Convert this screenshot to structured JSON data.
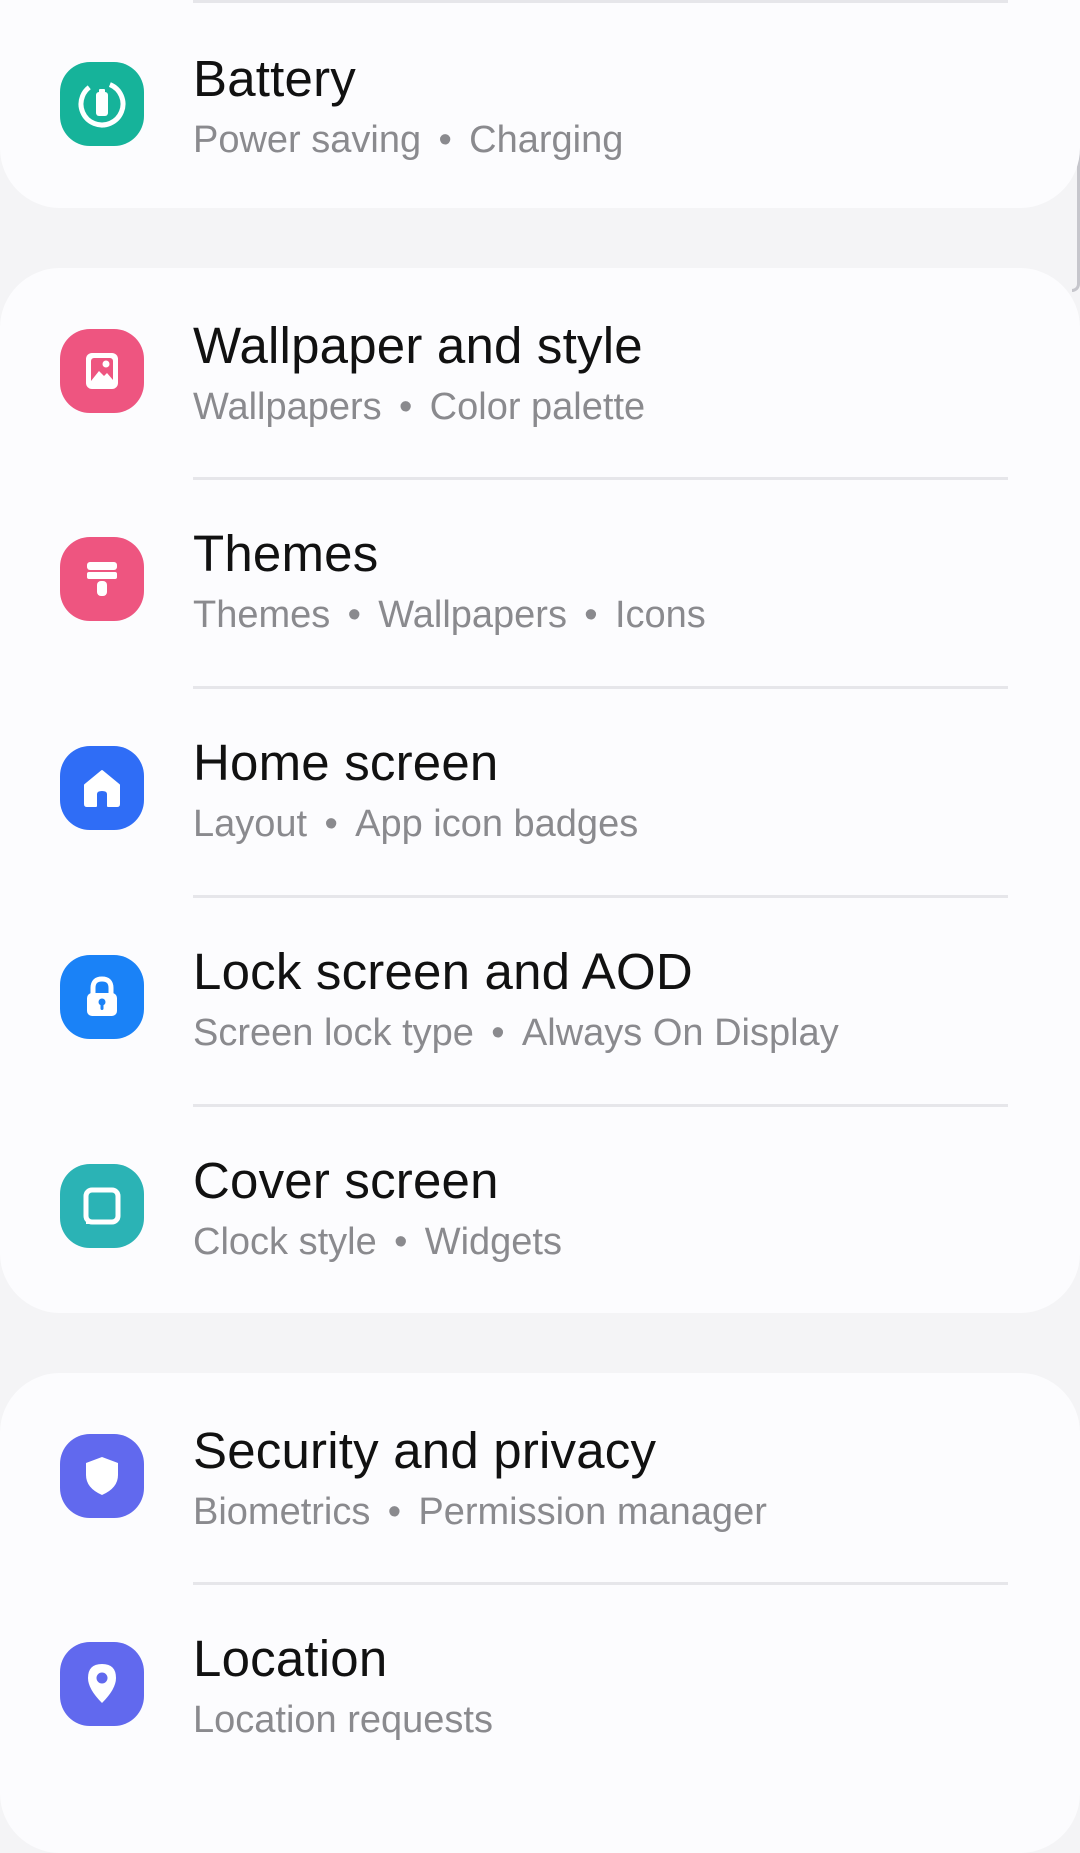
{
  "settings": {
    "battery": {
      "title": "Battery",
      "subtitle": [
        "Power saving",
        "Charging"
      ],
      "icon": "battery-icon",
      "color": "#16b39a"
    },
    "wallpaper": {
      "title": "Wallpaper and style",
      "subtitle": [
        "Wallpapers",
        "Color palette"
      ],
      "icon": "image-icon",
      "color": "#ee5580"
    },
    "themes": {
      "title": "Themes",
      "subtitle": [
        "Themes",
        "Wallpapers",
        "Icons"
      ],
      "icon": "paintbrush-icon",
      "color": "#ee5580"
    },
    "home_screen": {
      "title": "Home screen",
      "subtitle": [
        "Layout",
        "App icon badges"
      ],
      "icon": "home-icon",
      "color": "#2f6df6"
    },
    "lock_screen": {
      "title": "Lock screen and AOD",
      "subtitle": [
        "Screen lock type",
        "Always On Display"
      ],
      "icon": "lock-icon",
      "color": "#1a82f7"
    },
    "cover_screen": {
      "title": "Cover screen",
      "subtitle": [
        "Clock style",
        "Widgets"
      ],
      "icon": "cover-screen-icon",
      "color": "#2bb3b5"
    },
    "security": {
      "title": "Security and privacy",
      "subtitle": [
        "Biometrics",
        "Permission manager"
      ],
      "icon": "shield-icon",
      "color": "#6169ee"
    },
    "location": {
      "title": "Location",
      "subtitle": [
        "Location requests"
      ],
      "icon": "location-pin-icon",
      "color": "#6169ee"
    }
  }
}
